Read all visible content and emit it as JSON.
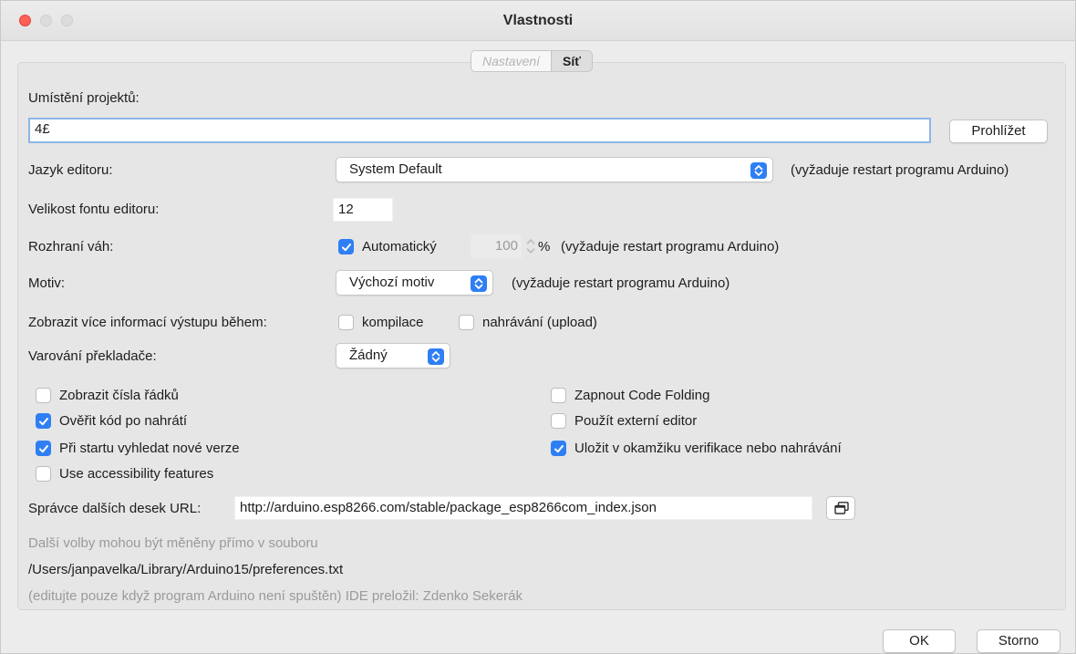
{
  "window": {
    "title": "Vlastnosti"
  },
  "tabs": [
    {
      "label": "Nastavení",
      "active": true
    },
    {
      "label": "Síť",
      "active": false
    }
  ],
  "settings": {
    "sketchbook_label": "Umístění projektů:",
    "sketchbook_value": "4£",
    "browse_label": "Prohlížet",
    "editor_lang_label": "Jazyk editoru:",
    "editor_lang_value": "System Default",
    "editor_lang_note": "(vyžaduje restart programu Arduino)",
    "font_size_label": "Velikost fontu editoru:",
    "font_size_value": "12",
    "scale_label": "Rozhraní váh:",
    "scale_auto_label": "Automatický",
    "scale_auto_checked": true,
    "scale_value": "100",
    "scale_percent": "%",
    "scale_note": "(vyžaduje restart programu Arduino)",
    "theme_label": "Motiv:",
    "theme_value": "Výchozí motiv",
    "theme_note": "(vyžaduje restart programu Arduino)",
    "verbose_label": "Zobrazit více informací výstupu během:",
    "verbose_compile_label": "kompilace",
    "verbose_compile_checked": false,
    "verbose_upload_label": "nahrávání (upload)",
    "verbose_upload_checked": false,
    "warnings_label": "Varování překladače:",
    "warnings_value": "Žádný"
  },
  "options_left": [
    {
      "label": "Zobrazit čísla řádků",
      "checked": false
    },
    {
      "label": "Ověřit kód po nahrátí",
      "checked": true
    },
    {
      "label": "Při startu vyhledat nové verze",
      "checked": true
    },
    {
      "label": "Use accessibility features",
      "checked": false
    }
  ],
  "options_right": [
    {
      "label": "Zapnout Code Folding",
      "checked": false
    },
    {
      "label": "Použít externí editor",
      "checked": false
    },
    {
      "label": "Uložit v okamžiku verifikace nebo nahrávání",
      "checked": true
    }
  ],
  "boards": {
    "label": "Správce dalších desek URL:",
    "value": "http://arduino.esp8266.com/stable/package_esp8266com_index.json"
  },
  "footer_info": {
    "line1": "Další volby mohou být měněny přímo v souboru",
    "path": "/Users/janpavelka/Library/Arduino15/preferences.txt",
    "line3": "(editujte pouze když program Arduino není spuštěn) IDE preložil: Zdenko Sekerák"
  },
  "buttons": {
    "ok": "OK",
    "cancel": "Storno"
  },
  "colors": {
    "accent": "#2f7ff4",
    "close": "#fe5f57"
  },
  "icons": {
    "select_arrow": "up-down-chevron-icon",
    "checkmark": "checkmark-icon",
    "boards_edit": "window-stack-icon"
  }
}
